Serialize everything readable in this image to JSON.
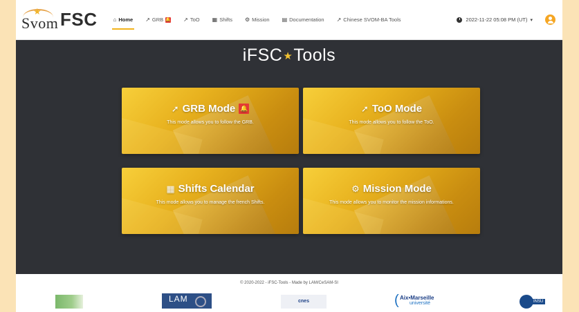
{
  "brand": {
    "svom": "Svom",
    "fsc": "FSC"
  },
  "nav": {
    "items": [
      {
        "label": "Home",
        "icon": "home-icon",
        "glyph": "⌂",
        "active": true
      },
      {
        "label": "GRB",
        "icon": "satellite-icon",
        "glyph": "↗",
        "badge": "🔔"
      },
      {
        "label": "ToO",
        "icon": "satellite-icon",
        "glyph": "↗"
      },
      {
        "label": "Shifts",
        "icon": "calendar-icon",
        "glyph": "▦"
      },
      {
        "label": "Mission",
        "icon": "gear-icon",
        "glyph": "⚙"
      },
      {
        "label": "Documentation",
        "icon": "book-icon",
        "glyph": "▤"
      },
      {
        "label": "Chinese SVOM-BA Tools",
        "icon": "external-link-icon",
        "glyph": "↗"
      }
    ],
    "datetime": "2022-11-22 05:08 PM (UT)"
  },
  "main": {
    "title_left": "iFSC",
    "title_right": "Tools",
    "cards": [
      {
        "title": "GRB Mode",
        "icon": "satellite-icon",
        "badge": "🔔",
        "desc": "This mode allows you to follow the GRB."
      },
      {
        "title": "ToO Mode",
        "icon": "satellite-icon",
        "desc": "This mode allows you to follow the ToO."
      },
      {
        "title": "Shifts Calendar",
        "icon": "calendar-icon",
        "desc": "This mode allows you to manage the french Shifts."
      },
      {
        "title": "Mission Mode",
        "icon": "gear-icon",
        "desc": "This mode allows you to monitor the mission informations."
      }
    ]
  },
  "footer": {
    "copyright": "© 2020-2022 - iFSC-Tools - Made by LAM/CeSAM-SI",
    "logos": {
      "lam": "LAM",
      "cnes": "cnes",
      "amu_line1": "Aix•Marseille",
      "amu_line2": "université",
      "insu": "INSU"
    }
  },
  "colors": {
    "accent": "#f2b31a",
    "badge": "#e53935",
    "background": "#2f3136"
  }
}
